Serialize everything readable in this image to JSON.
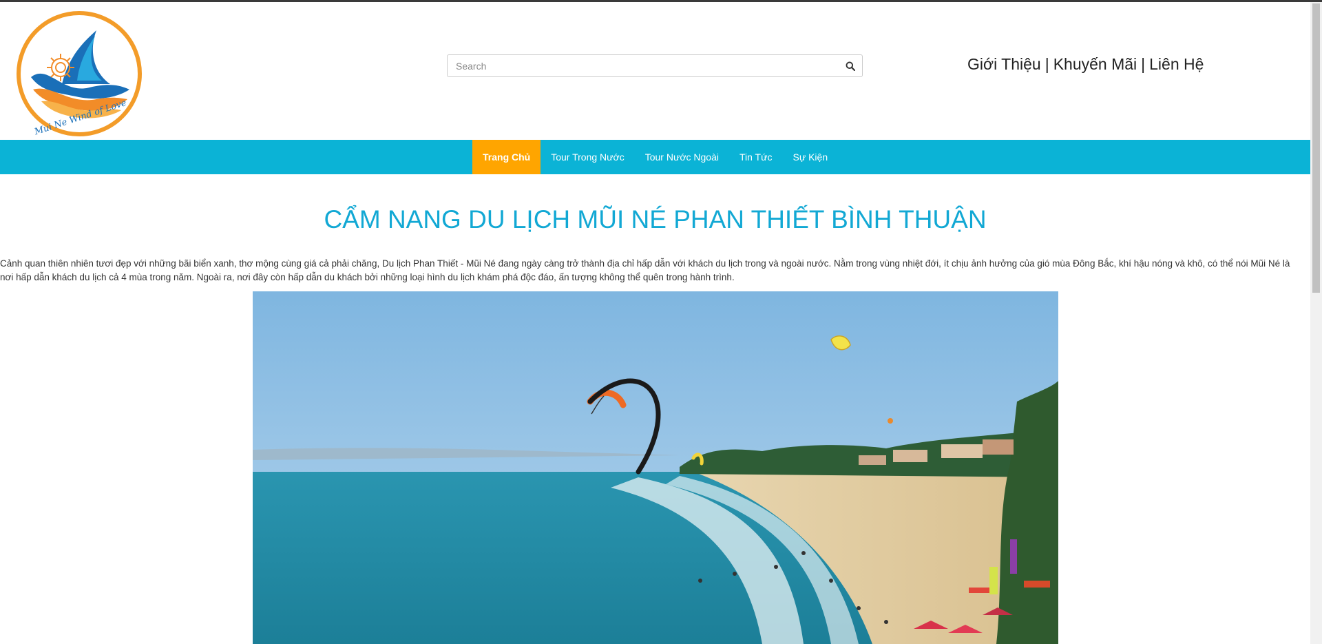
{
  "logo": {
    "tagline": "Mui Ne Wind of Love",
    "colors": {
      "ring": "#f39c29",
      "wave_blue": "#1a6fb8",
      "wave_orange": "#f28c28"
    }
  },
  "search": {
    "placeholder": "Search",
    "value": ""
  },
  "top_links": [
    {
      "label": "Giới Thiệu"
    },
    {
      "label": "Khuyến Mãi"
    },
    {
      "label": "Liên Hệ"
    }
  ],
  "top_links_separator": "|",
  "nav": {
    "items": [
      {
        "label": "Trang Chủ",
        "active": true
      },
      {
        "label": "Tour Trong Nước",
        "active": false
      },
      {
        "label": "Tour Nước Ngoài",
        "active": false
      },
      {
        "label": "Tin Tức",
        "active": false
      },
      {
        "label": "Sự Kiện",
        "active": false
      }
    ]
  },
  "main": {
    "title": "CẨM NANG DU LỊCH MŨI NÉ PHAN THIẾT BÌNH THUẬN",
    "intro": "Cảnh quan thiên nhiên tươi đẹp với những bãi biển xanh, thơ mộng cùng giá cả phải chăng, Du lịch Phan Thiết - Mũi Né đang ngày càng trở thành địa chỉ hấp dẫn với khách du lịch trong và ngoài nước. Nằm trong vùng nhiệt đới, ít chịu ảnh hưởng của gió mùa Đông Bắc, khí hậu nóng và khô, có thể nói Mũi Né là nơi hấp dẫn khách du lịch cả 4 mùa trong năm. Ngoài ra, nơi đây còn hấp dẫn du khách bởi những loại hình du lịch khám phá độc đáo, ấn tượng không thể quên trong hành trình."
  },
  "colors": {
    "nav_bg": "#0bb3d6",
    "nav_active": "#ffa500",
    "title": "#12a8d4"
  }
}
